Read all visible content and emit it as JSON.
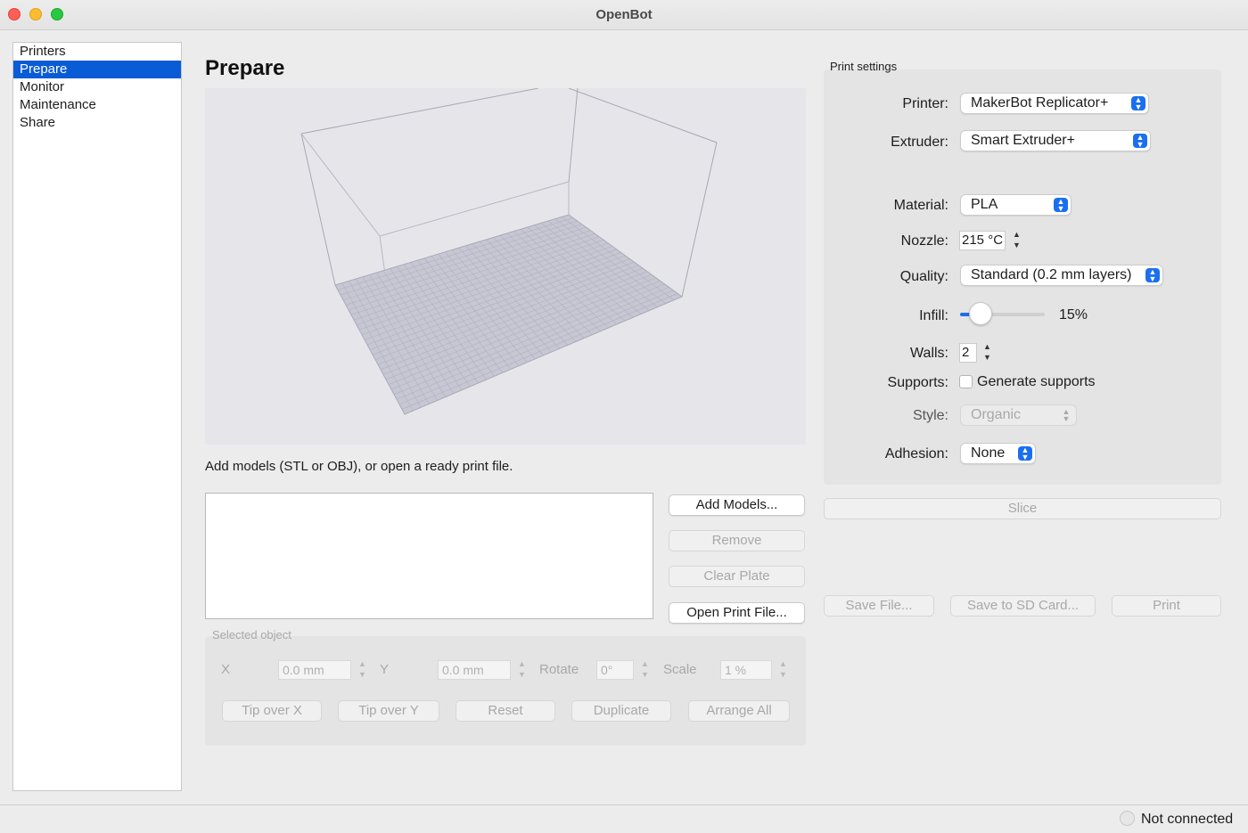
{
  "window": {
    "title": "OpenBot"
  },
  "sidebar": {
    "items": [
      {
        "label": "Printers",
        "selected": false
      },
      {
        "label": "Prepare",
        "selected": true
      },
      {
        "label": "Monitor",
        "selected": false
      },
      {
        "label": "Maintenance",
        "selected": false
      },
      {
        "label": "Share",
        "selected": false
      }
    ]
  },
  "main": {
    "title": "Prepare",
    "hint": "Add models (STL or OBJ), or open a ready print file.",
    "buttons": {
      "add_models": "Add Models...",
      "remove": "Remove",
      "clear_plate": "Clear Plate",
      "open_print_file": "Open Print File..."
    }
  },
  "selected_object": {
    "label": "Selected object",
    "x_label": "X",
    "x_value": "0.0 mm",
    "y_label": "Y",
    "y_value": "0.0 mm",
    "rotate_label": "Rotate",
    "rotate_value": "0°",
    "scale_label": "Scale",
    "scale_value": "1 %",
    "buttons": {
      "tip_x": "Tip over X",
      "tip_y": "Tip over Y",
      "reset": "Reset",
      "duplicate": "Duplicate",
      "arrange_all": "Arrange All"
    }
  },
  "print_settings": {
    "label": "Print settings",
    "printer_label": "Printer:",
    "printer_value": "MakerBot Replicator+",
    "extruder_label": "Extruder:",
    "extruder_value": "Smart Extruder+",
    "material_label": "Material:",
    "material_value": "PLA",
    "nozzle_label": "Nozzle:",
    "nozzle_value": "215 °C",
    "quality_label": "Quality:",
    "quality_value": "Standard (0.2 mm layers)",
    "infill_label": "Infill:",
    "infill_value": "15%",
    "infill_fraction": 0.15,
    "walls_label": "Walls:",
    "walls_value": "2",
    "supports_label": "Supports:",
    "supports_checkbox": "Generate supports",
    "supports_checked": false,
    "style_label": "Style:",
    "style_value": "Organic",
    "adhesion_label": "Adhesion:",
    "adhesion_value": "None"
  },
  "actions": {
    "slice": "Slice",
    "save_file": "Save File...",
    "save_sd": "Save to SD Card...",
    "print": "Print"
  },
  "status": {
    "connection": "Not connected"
  },
  "colors": {
    "accent": "#0a5bd6",
    "popup_chevron": "#1a6ff0"
  },
  "icons": [
    "close-window-icon",
    "minimize-window-icon",
    "zoom-window-icon",
    "build-volume-grid-icon",
    "status-indicator-icon"
  ]
}
